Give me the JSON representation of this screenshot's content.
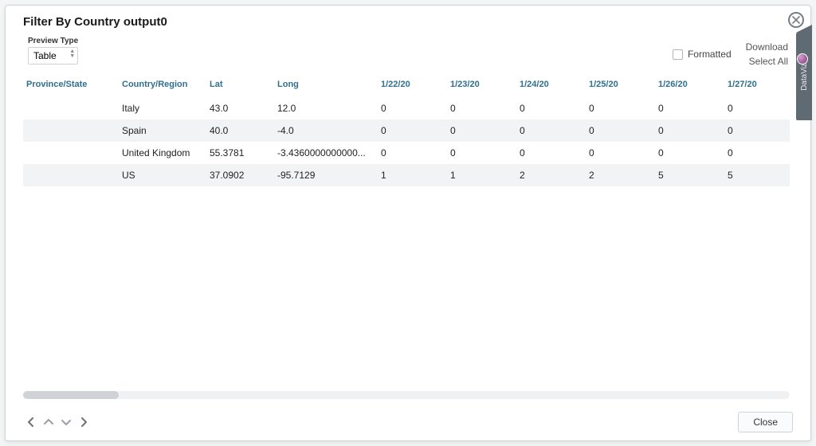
{
  "title": "Filter By Country output0",
  "preview": {
    "label": "Preview Type",
    "value": "Table"
  },
  "controls": {
    "formatted_label": "Formatted",
    "download_label": "Download",
    "select_all_label": "Select All"
  },
  "table": {
    "headers": [
      "Province/State",
      "Country/Region",
      "Lat",
      "Long",
      "1/22/20",
      "1/23/20",
      "1/24/20",
      "1/25/20",
      "1/26/20",
      "1/27/20"
    ],
    "rows": [
      [
        "",
        "Italy",
        "43.0",
        "12.0",
        "0",
        "0",
        "0",
        "0",
        "0",
        "0"
      ],
      [
        "",
        "Spain",
        "40.0",
        "-4.0",
        "0",
        "0",
        "0",
        "0",
        "0",
        "0"
      ],
      [
        "",
        "United Kingdom",
        "55.3781",
        "-3.4360000000000...",
        "0",
        "0",
        "0",
        "0",
        "0",
        "0"
      ],
      [
        "",
        "US",
        "37.0902",
        "-95.7129",
        "1",
        "1",
        "2",
        "2",
        "5",
        "5"
      ]
    ]
  },
  "footer": {
    "close_label": "Close"
  },
  "side": {
    "label": "DataViz"
  },
  "colors": {
    "header_text": "#2f6f8f",
    "stripe": "#f2f3f4",
    "sidetab": "#5f6a73"
  }
}
